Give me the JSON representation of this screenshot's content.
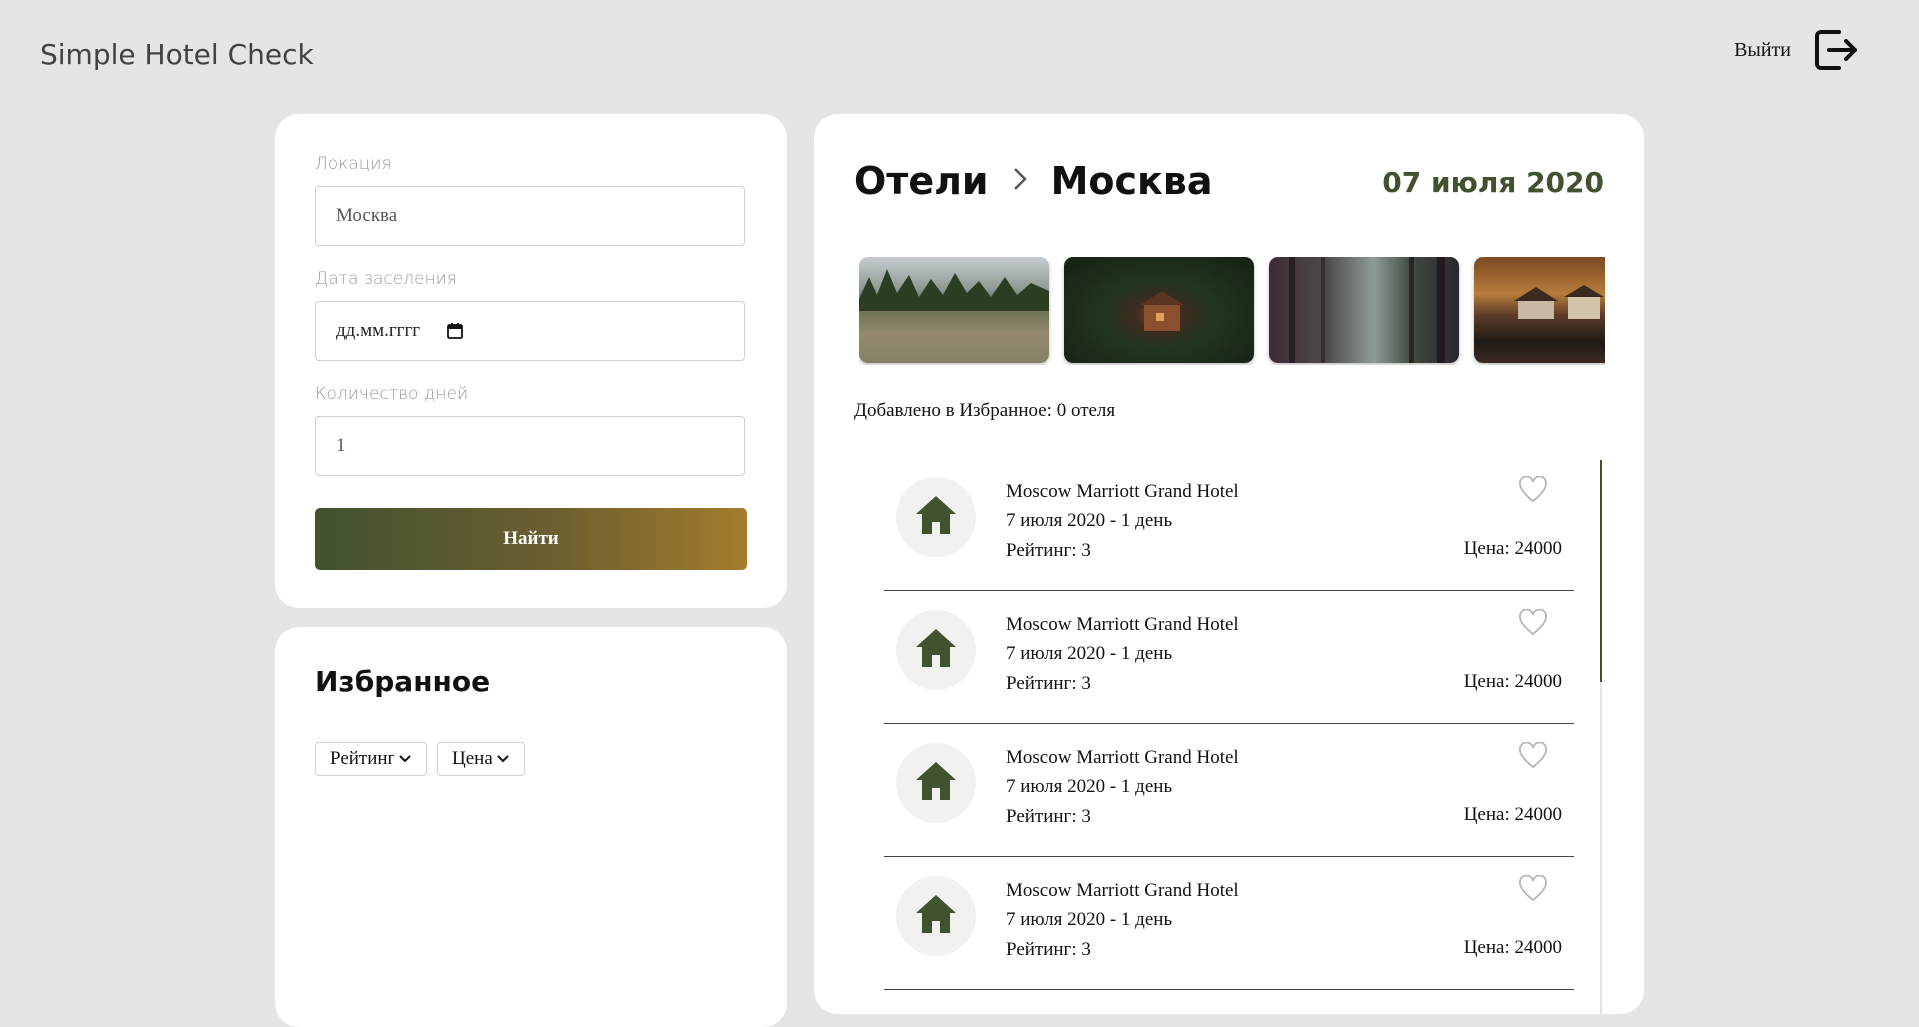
{
  "app": {
    "title": "Simple Hotel Check"
  },
  "header": {
    "logout_label": "Выйти"
  },
  "search": {
    "location_label": "Локация",
    "location_value": "Москва",
    "checkin_label": "Дата заселения",
    "checkin_value": "дд.мм.гггг",
    "days_label": "Количество дней",
    "days_value": "1",
    "submit_label": "Найти"
  },
  "favorites": {
    "title": "Избранное",
    "sort_rating_label": "Рейтинг",
    "sort_price_label": "Цена"
  },
  "hotels": {
    "breadcrumb_root": "Отели",
    "breadcrumb_city": "Москва",
    "date": "07 июля 2020",
    "favorites_count_text": "Добавлено в Избранное: 0 отеля",
    "items": [
      {
        "name": "Moscow Marriott Grand Hotel",
        "dates": "7 июля 2020 - 1 день",
        "rating": "Рейтинг: 3",
        "price": "Цена: 24000"
      },
      {
        "name": "Moscow Marriott Grand Hotel",
        "dates": "7 июля 2020 - 1 день",
        "rating": "Рейтинг: 3",
        "price": "Цена: 24000"
      },
      {
        "name": "Moscow Marriott Grand Hotel",
        "dates": "7 июля 2020 - 1 день",
        "rating": "Рейтинг: 3",
        "price": "Цена: 24000"
      },
      {
        "name": "Moscow Marriott Grand Hotel",
        "dates": "7 июля 2020 - 1 день",
        "rating": "Рейтинг: 3",
        "price": "Цена: 24000"
      }
    ]
  },
  "icons": {
    "logout": "logout-icon",
    "calendar": "calendar-icon",
    "chevron": "chevron-right-icon",
    "house": "house-icon",
    "heart": "heart-outline-icon",
    "select": "chevron-down-icon"
  },
  "colors": {
    "accent": "#41522f",
    "gold": "#a37d2c",
    "background": "#e5e5e5"
  }
}
